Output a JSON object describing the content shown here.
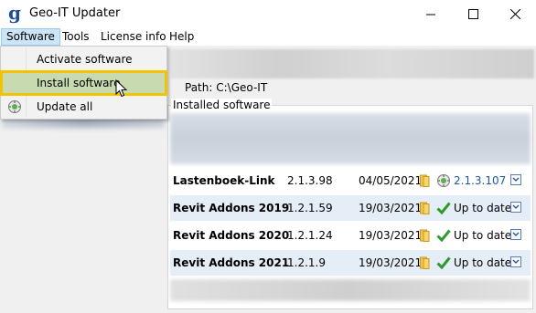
{
  "window": {
    "title": "Geo-IT Updater"
  },
  "menubar": {
    "items": [
      "Software",
      "Tools",
      "License info",
      "Help"
    ]
  },
  "software_menu": {
    "items": [
      "Activate software",
      "Install software",
      "Update all"
    ]
  },
  "path": {
    "label": "Path:",
    "value": "C:\\Geo-IT"
  },
  "installed": {
    "title": "Installed software",
    "rows": [
      {
        "name": "Lastenboek-Link",
        "version": "2.1.3.98",
        "date": "04/05/2021",
        "status": "2.1.3.107",
        "status_type": "update"
      },
      {
        "name": "Revit Addons 2019",
        "version": "1.2.1.59",
        "date": "19/03/2021",
        "status": "Up to date",
        "status_type": "ok"
      },
      {
        "name": "Revit Addons 2020",
        "version": "1.2.1.24",
        "date": "19/03/2021",
        "status": "Up to date",
        "status_type": "ok"
      },
      {
        "name": "Revit Addons 2021",
        "version": "1.2.1.9",
        "date": "19/03/2021",
        "status": "Up to date",
        "status_type": "ok"
      }
    ]
  },
  "colors": {
    "highlight_border": "#f2c400",
    "highlight_fill": "#c8dbb0",
    "row_alt": "#e5edf7",
    "check": "#2e9a2e"
  }
}
